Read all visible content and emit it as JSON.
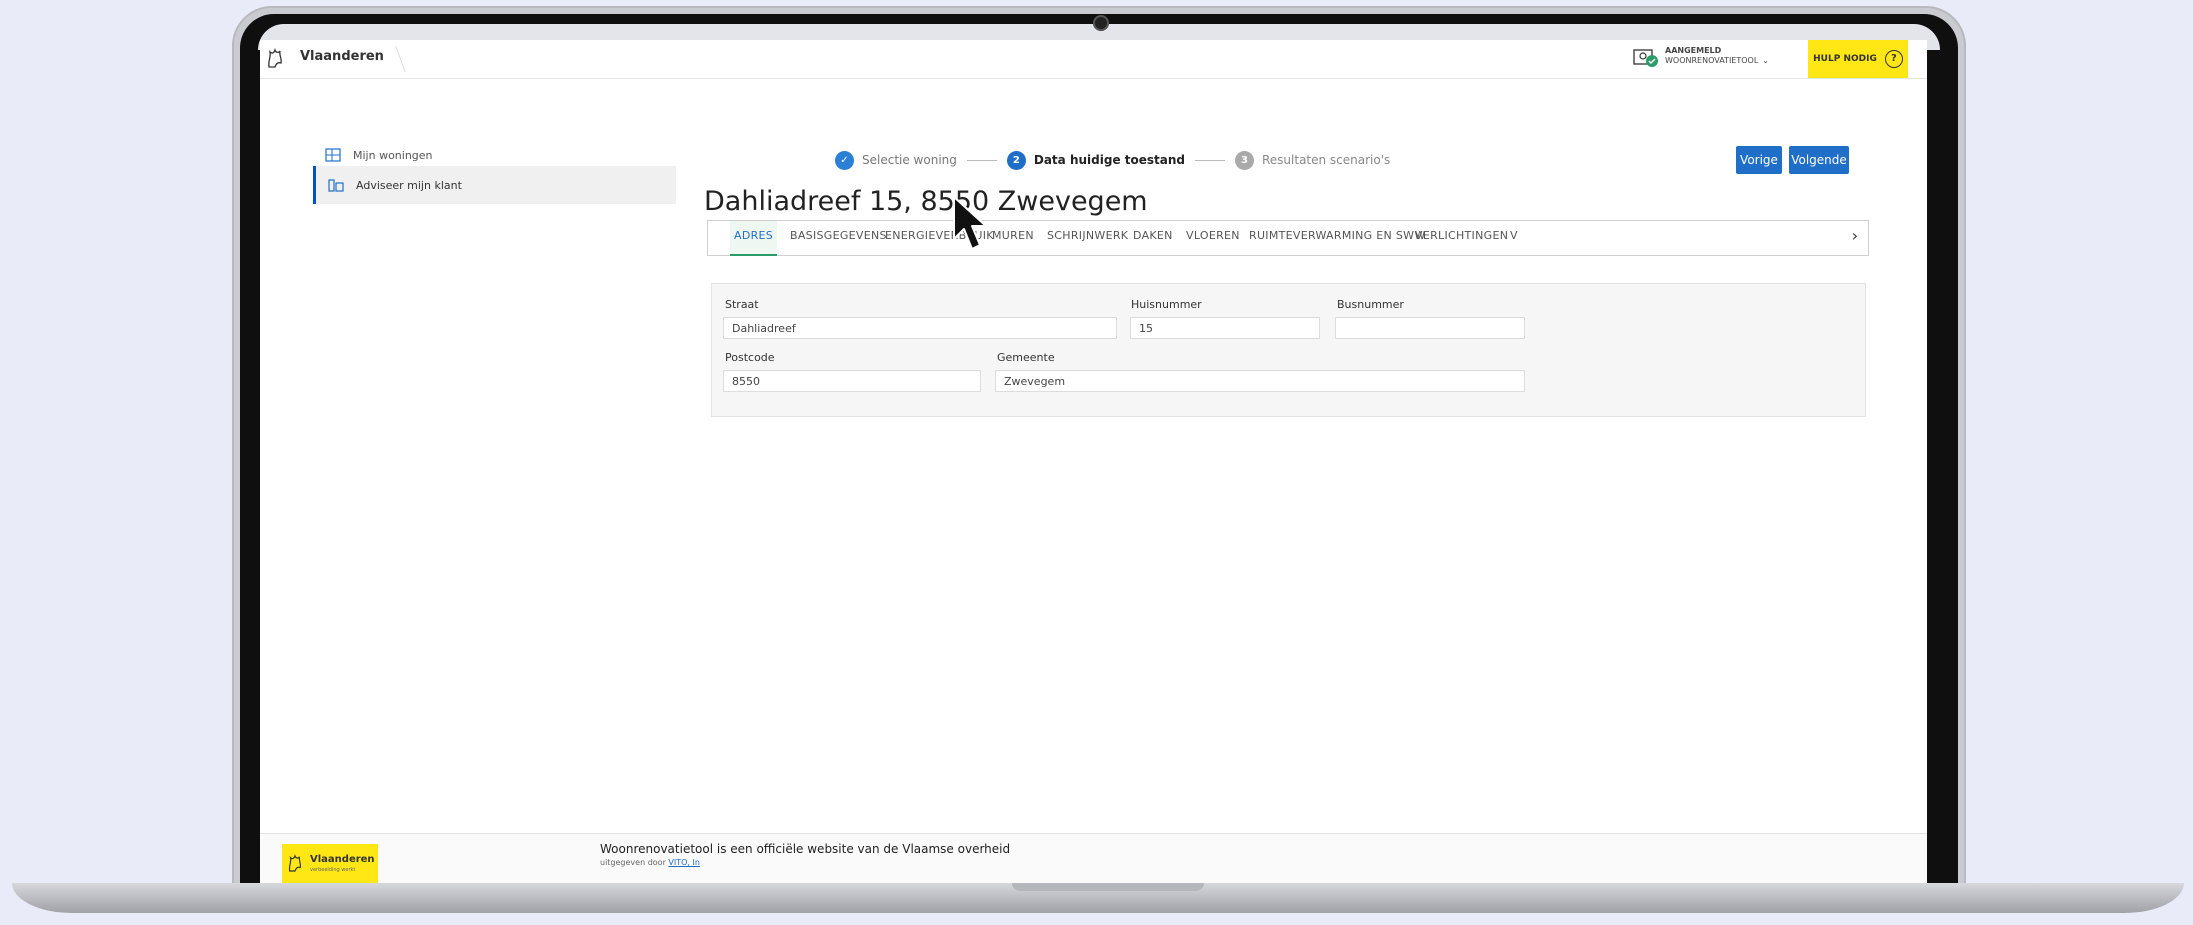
{
  "header": {
    "brand": "Vlaanderen",
    "login_status": "AANGEMELD",
    "login_app": "WOONRENOVATIETOOL",
    "help_label": "HULP NODIG"
  },
  "sidebar": {
    "items": [
      {
        "label": "Mijn woningen"
      },
      {
        "label": "Adviseer mijn klant"
      }
    ]
  },
  "stepper": {
    "steps": [
      {
        "number": "",
        "label": "Selectie woning",
        "state": "done"
      },
      {
        "number": "2",
        "label": "Data huidige toestand",
        "state": "current"
      },
      {
        "number": "3",
        "label": "Resultaten scenario's",
        "state": "todo"
      }
    ],
    "prev_label": "Vorige",
    "next_label": "Volgende"
  },
  "page": {
    "title": "Dahliadreef 15, 8550 Zwevegem"
  },
  "tabs": [
    {
      "label": "ADRES",
      "active": true
    },
    {
      "label": "BASISGEGEVENS"
    },
    {
      "label": "ENERGIEVERBRUIK"
    },
    {
      "label": "MUREN"
    },
    {
      "label": "SCHRIJNWERK"
    },
    {
      "label": "DAKEN"
    },
    {
      "label": "VLOEREN"
    },
    {
      "label": "RUIMTEVERWARMING EN SWW"
    },
    {
      "label": "VERLICHTINGEN"
    },
    {
      "label": "V"
    }
  ],
  "form": {
    "straat": {
      "label": "Straat",
      "value": "Dahliadreef"
    },
    "huisnummer": {
      "label": "Huisnummer",
      "value": "15"
    },
    "busnummer": {
      "label": "Busnummer",
      "value": ""
    },
    "postcode": {
      "label": "Postcode",
      "value": "8550"
    },
    "gemeente": {
      "label": "Gemeente",
      "value": "Zwevegem"
    }
  },
  "footer": {
    "logo_name": "Vlaanderen",
    "logo_tagline": "verbeelding werkt",
    "title": "Woonrenovatietool is een officiële website van de Vlaamse overheid",
    "sub_prefix": "uitgegeven door",
    "sub_link": "VITO, In"
  },
  "colors": {
    "accent": "#1f6fc9",
    "yellow": "#ffe615",
    "tab_active_underline": "#2a9d6a",
    "background": "#e9ebf8"
  },
  "icons": [
    "lion-logo-icon",
    "login-user-icon",
    "help-icon",
    "home-list-icon",
    "advise-icon",
    "check-icon",
    "chevron-right-icon",
    "mouse-cursor-icon"
  ]
}
